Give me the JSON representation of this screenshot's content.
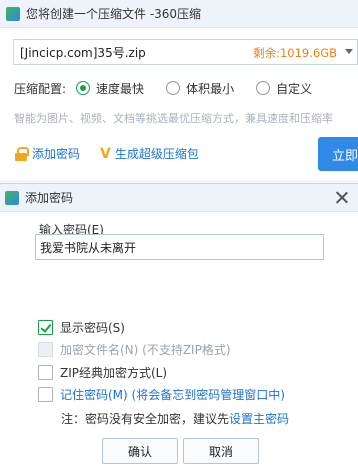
{
  "main_window": {
    "title": "您将创建一个压缩文件 -360压缩",
    "file_name": "[Jincicp.com]35号.zip",
    "free_space": "剩余:1019.6GB",
    "options_label": "压缩配置:",
    "options": [
      {
        "label": "速度最快",
        "selected": true
      },
      {
        "label": "体积最小",
        "selected": false
      },
      {
        "label": "自定义",
        "selected": false
      }
    ],
    "hint": "智能为图片、视频、文档等挑选最优压缩方式，兼具速度和压缩率",
    "add_password_link": "添加密码",
    "super_package_link": "生成超级压缩包",
    "compress_button": "立即压缩"
  },
  "dialog": {
    "title": "添加密码",
    "password_label": "输入密码(E)",
    "password_value": "我爱书院从未离开",
    "checkboxes": [
      {
        "label": "显示密码(S)",
        "checked": true,
        "disabled": false
      },
      {
        "label": "加密文件名(N) (不支持ZIP格式)",
        "checked": false,
        "disabled": true
      },
      {
        "label": "ZIP经典加密方式(L)",
        "checked": false,
        "disabled": false
      },
      {
        "label": "记住密码(M) (将会备忘到密码管理窗口中)",
        "checked": false,
        "disabled": false
      }
    ],
    "note_prefix": "注：密码没有安全加密，建议先",
    "note_link": "设置主密码",
    "ok_button": "确认",
    "cancel_button": "取消"
  },
  "colors": {
    "accent_green": "#1aa04a",
    "link_blue": "#1a73d9",
    "warning_orange": "#ef7d11",
    "primary_button": "#2e8ae6"
  }
}
